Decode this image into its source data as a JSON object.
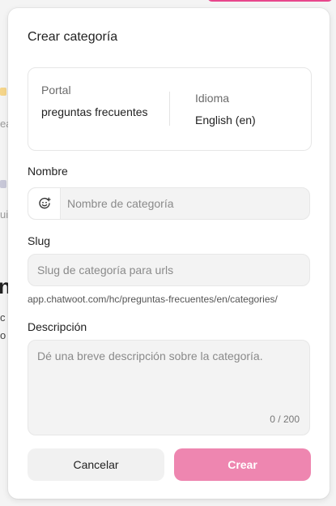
{
  "background": {
    "fragments": [
      "ea",
      "ui",
      "n",
      "c",
      "o"
    ]
  },
  "modal": {
    "title": "Crear categoría",
    "portal": {
      "label": "Portal",
      "value": "preguntas frecuentes"
    },
    "language": {
      "label": "Idioma",
      "value": "English (en)"
    },
    "name_field": {
      "label": "Nombre",
      "placeholder": "Nombre de categoría",
      "value": "",
      "icon": "emoji-smile-icon"
    },
    "slug_field": {
      "label": "Slug",
      "placeholder": "Slug de categoría para urls",
      "value": "",
      "hint": "app.chatwoot.com/hc/preguntas-frecuentes/en/categories/"
    },
    "description_field": {
      "label": "Descripción",
      "placeholder": "Dé una breve descripción sobre la categoría.",
      "value": "",
      "char_count": "0 / 200"
    },
    "buttons": {
      "cancel": "Cancelar",
      "create": "Crear"
    }
  },
  "colors": {
    "accent": "#e8478c",
    "create_button_disabled": "#ee86b0",
    "input_bg": "#f3f3f3"
  }
}
